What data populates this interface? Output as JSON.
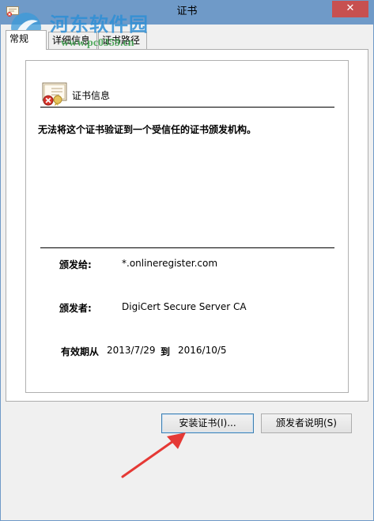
{
  "window": {
    "title": "证书",
    "close_label": "✕"
  },
  "watermark": {
    "title": "河东软件园",
    "url": "www.pc0359.cn"
  },
  "tabs": [
    {
      "label": "常规",
      "active": true
    },
    {
      "label": "详细信息",
      "active": false
    },
    {
      "label": "证书路径",
      "active": false
    }
  ],
  "certificate_info": {
    "heading": "证书信息",
    "warning": "无法将这个证书验证到一个受信任的证书颁发机构。",
    "issued_to_label": "颁发给:",
    "issued_to_value": "*.onlineregister.com",
    "issued_by_label": "颁发者:",
    "issued_by_value": "DigiCert Secure Server CA",
    "validity_label": "有效期从",
    "valid_from": "2013/7/29",
    "validity_to_label": "到",
    "valid_to": "2016/10/5"
  },
  "buttons": {
    "install_label": "安装证书(I)...",
    "issuer_statement_label": "颁发者说明(S)"
  },
  "icons": {
    "window": "certificate-icon",
    "certificate": "certificate-error-icon",
    "annotation": "red-arrow"
  },
  "colors": {
    "titlebar": "#6f9ac8",
    "close": "#c75050",
    "arrow": "#e53935",
    "focus_border": "#3c7fb1"
  }
}
